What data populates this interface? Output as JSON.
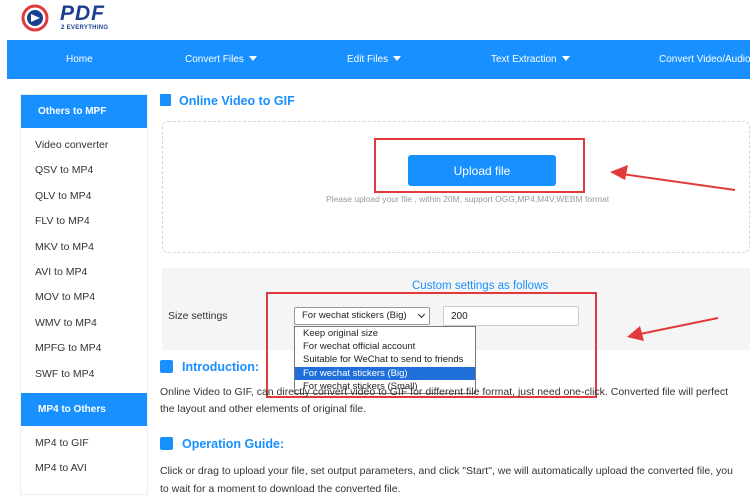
{
  "logo": {
    "text": "PDF",
    "subtext": "2 EVERYTHING"
  },
  "nav": [
    {
      "label": "Home",
      "dropdown": false
    },
    {
      "label": "Convert Files",
      "dropdown": true
    },
    {
      "label": "Edit Files",
      "dropdown": true
    },
    {
      "label": "Text Extraction",
      "dropdown": true
    },
    {
      "label": "Convert Video/Audio",
      "dropdown": false
    }
  ],
  "sidebar": {
    "section1": "Others to MPF",
    "items1": [
      "Video converter",
      "QSV to MP4",
      "QLV to MP4",
      "FLV to MP4",
      "MKV to MP4",
      "AVI to MP4",
      "MOV to MP4",
      "WMV to MP4",
      "MPFG to MP4",
      "SWF to MP4"
    ],
    "section2": "MP4 to Others",
    "items2": [
      "MP4 to GIF",
      "MP4 to AVI"
    ]
  },
  "main": {
    "title": "Online Video to GIF",
    "upload_label": "Upload file",
    "upload_hint": "Please upload your file , within 20M, support OGG,MP4,M4V,WEBM format",
    "custom_title": "Custom settings as follows",
    "size_label": "Size settings",
    "select_value": "For wechat stickers (Big)",
    "size_value": "200",
    "dropdown_options": [
      "Keep original size",
      "For wechat official account",
      "Suitable for WeChat to send to friends",
      "For wechat stickers (Big)",
      "For wechat stickers (Small)"
    ],
    "selected_index": 3
  },
  "intro": {
    "title": "Introduction:",
    "line1": "Online Video to GIF, can directly convert video to GIF for different file format, just need one-click. Converted file will perfect",
    "line2": "the layout and other elements of original file."
  },
  "guide": {
    "title": "Operation Guide:",
    "line1": "Click or drag to upload your file, set output parameters, and click \"Start\", we will automatically upload the converted file, you",
    "line2": "to wait for a moment to download the converted file."
  },
  "colors": {
    "accent": "#1890ff",
    "annotation": "#e23a3a"
  }
}
